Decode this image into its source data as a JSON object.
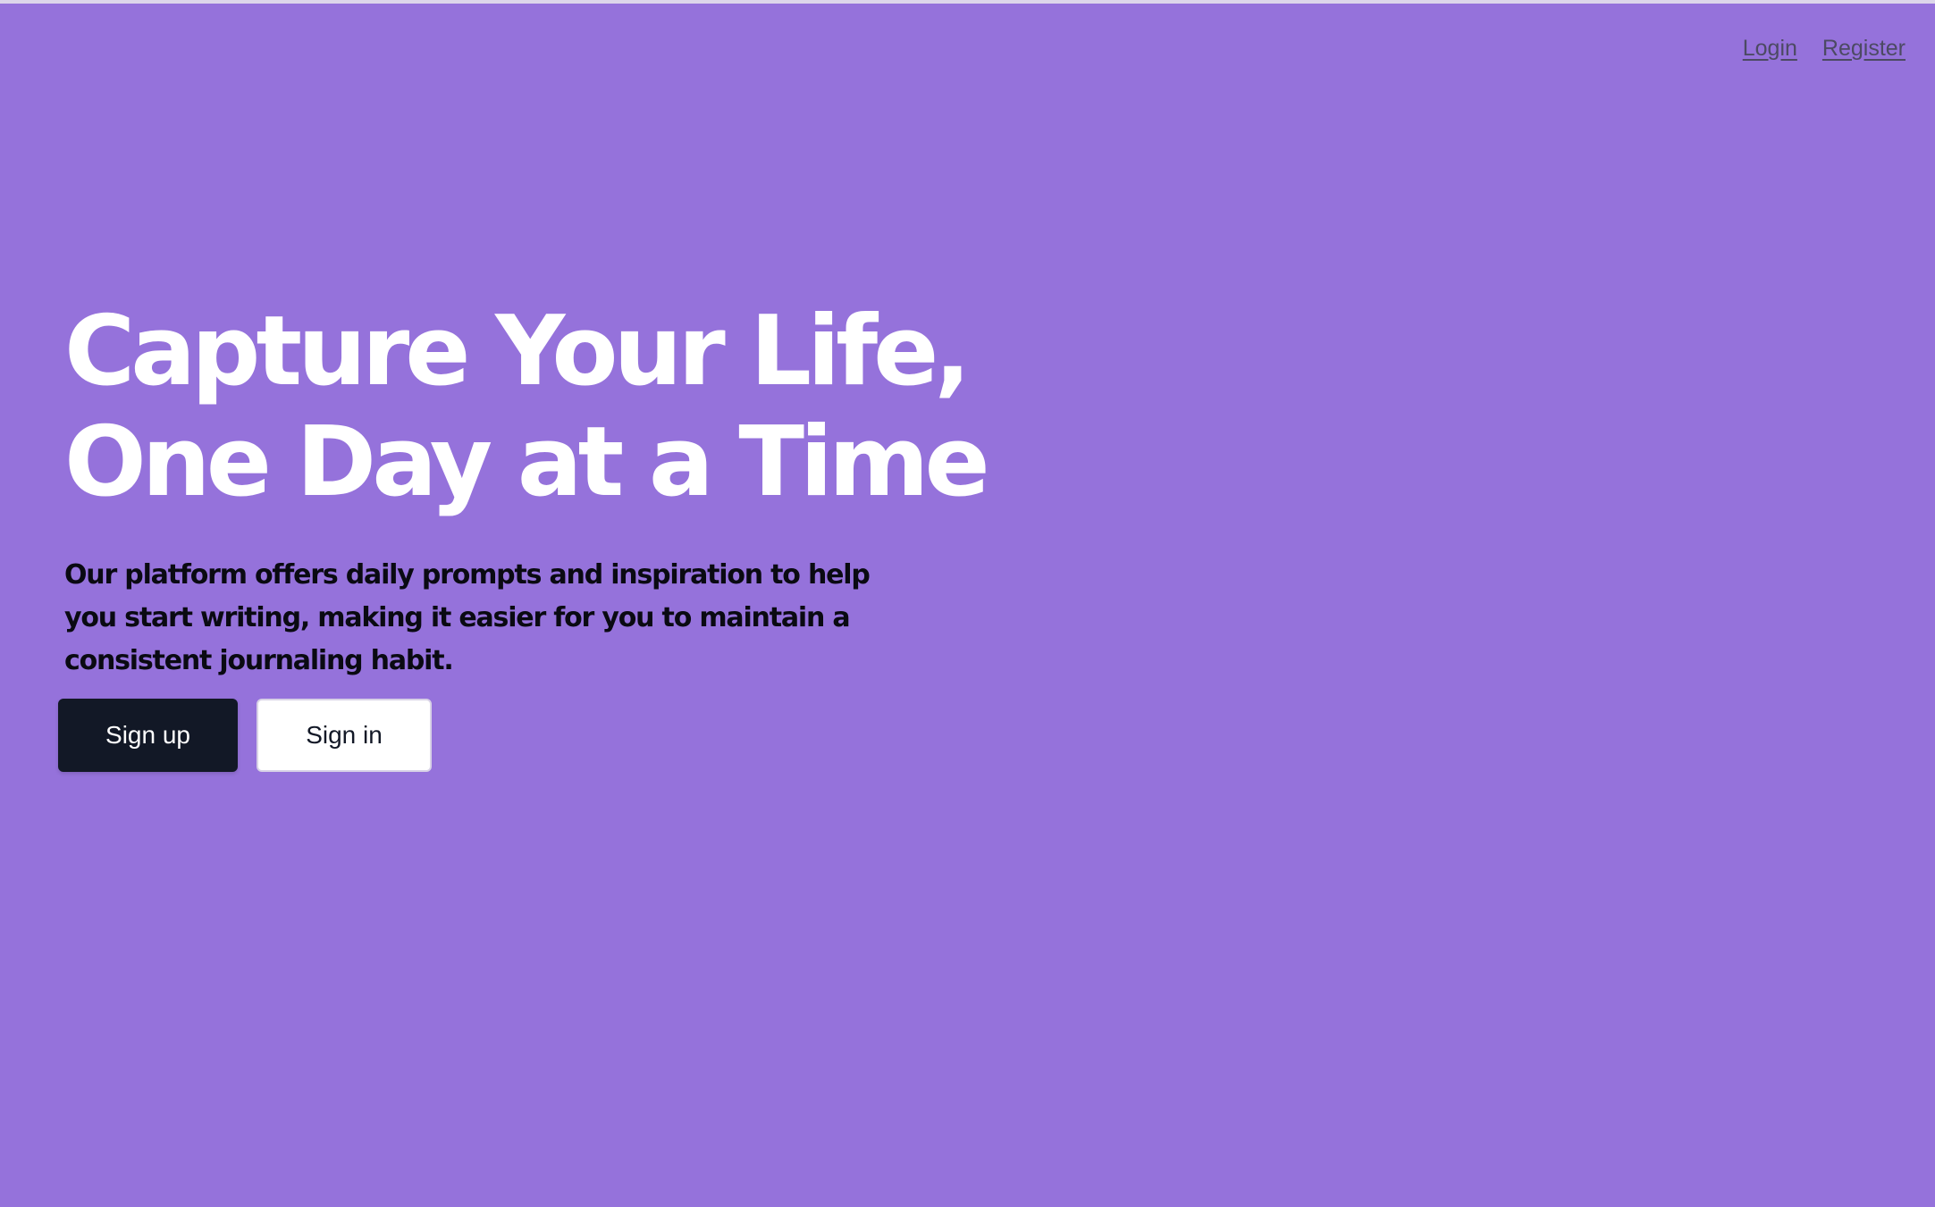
{
  "nav": {
    "login_label": "Login",
    "register_label": "Register"
  },
  "hero": {
    "title_line1": "Capture Your Life,",
    "title_line2": "One Day at a Time",
    "description": "Our platform offers daily prompts and inspiration to help you start writing, making it easier for you to maintain a consistent journaling habit."
  },
  "actions": {
    "signup_label": "Sign up",
    "signin_label": "Sign in"
  },
  "colors": {
    "background": "#9572db",
    "primary_button": "#121826",
    "secondary_button": "#ffffff"
  }
}
